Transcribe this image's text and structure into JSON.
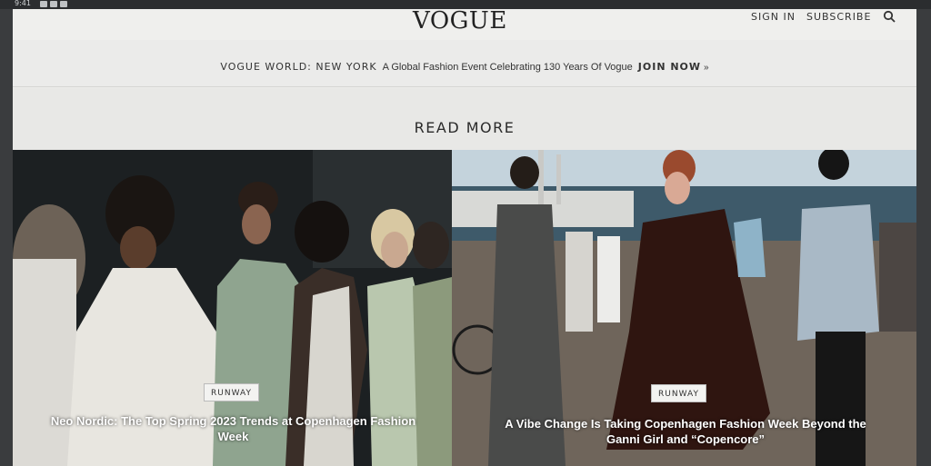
{
  "device": {
    "time": "9:41"
  },
  "header": {
    "logo": "VOGUE",
    "sign_in": "SIGN IN",
    "subscribe": "SUBSCRIBE",
    "search_icon": "search-icon"
  },
  "banner": {
    "event": "VOGUE WORLD: NEW YORK",
    "description": "A Global Fashion Event Celebrating 130 Years Of Vogue",
    "cta": "JOIN NOW",
    "arrow": "»"
  },
  "read_more": {
    "title": "READ MORE"
  },
  "articles": [
    {
      "tag": "RUNWAY",
      "headline": "Neo Nordic: The Top Spring 2023 Trends at Copenhagen Fashion Week"
    },
    {
      "tag": "RUNWAY",
      "headline": "A Vibe Change Is Taking Copenhagen Fashion Week Beyond the Ganni Girl and “Copencore”"
    }
  ],
  "colors": {
    "page_bg": "#ececea",
    "text": "#222222",
    "badge_bg": "#f3f3f1"
  }
}
